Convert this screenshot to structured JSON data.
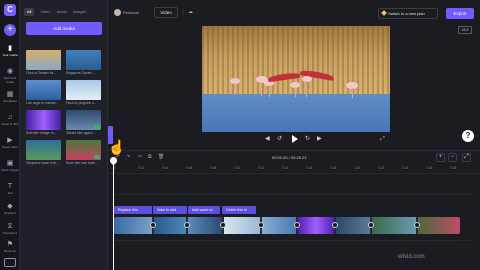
{
  "sidebar": {
    "logo": "C",
    "add": "+",
    "items": [
      {
        "label": "Your media",
        "icon": "folder-icon",
        "glyph": "▮",
        "active": true
      },
      {
        "label": "Record & create",
        "icon": "record-icon",
        "glyph": "◉",
        "active": false
      },
      {
        "label": "Templates",
        "icon": "templates-icon",
        "glyph": "▦",
        "active": false
      },
      {
        "label": "Music & SFX",
        "icon": "music-icon",
        "glyph": "♫",
        "active": false
      },
      {
        "label": "Stock video",
        "icon": "stock-video-icon",
        "glyph": "▶",
        "active": false
      },
      {
        "label": "Stock images",
        "icon": "stock-images-icon",
        "glyph": "▣",
        "active": false
      },
      {
        "label": "Text",
        "icon": "text-icon",
        "glyph": "T",
        "active": false
      },
      {
        "label": "Graphics",
        "icon": "graphics-icon",
        "glyph": "◆",
        "active": false
      },
      {
        "label": "Transitions",
        "icon": "transitions-icon",
        "glyph": "⧖",
        "active": false
      },
      {
        "label": "Brand kit",
        "icon": "brand-kit-icon",
        "glyph": "⚑",
        "active": false
      }
    ]
  },
  "media_panel": {
    "tabs": [
      "All",
      "Video",
      "Audio",
      "Images"
    ],
    "add_media_label": "Add media",
    "items": [
      {
        "label": "Flock of Greater fla...",
        "checked": false
      },
      {
        "label": "Singapore Garden ...",
        "checked": false
      },
      {
        "label": "Low angle of roseate...",
        "checked": false
      },
      {
        "label": "Flock of penguins o...",
        "checked": false
      },
      {
        "label": "Scientific vintage re...",
        "checked": false
      },
      {
        "label": "Vibrant blue agave ...",
        "checked": true
      },
      {
        "label": "Telephone tower is th...",
        "checked": false
      },
      {
        "label": "Rose with rose bush...",
        "checked": true
      }
    ]
  },
  "topbar": {
    "workspace": "Personal",
    "title": "Video",
    "switch_label": "Switch to a new plan",
    "export_label": "Export",
    "ratio": "16:9"
  },
  "player": {
    "rewind": "◀",
    "back5": "↺",
    "forward5": "↻",
    "skip": "▶",
    "fullscreen": "⤢",
    "help": "?"
  },
  "timeline": {
    "timecode": "00:00.00 / 00:29.23",
    "zoom_in": "+",
    "zoom_out": "−",
    "ruler_labels": [
      "0",
      "0:02",
      "0:04",
      "0:06",
      "0:08",
      "0:10",
      "0:12",
      "0:14",
      "0:16",
      "0:18",
      "0:20",
      "0:22",
      "0:24",
      "0:26",
      "0:28"
    ],
    "text_clips": [
      "Replace this",
      "Want to add",
      "Add some ex",
      "Delete this te"
    ],
    "watermark": "wtvid.com"
  }
}
